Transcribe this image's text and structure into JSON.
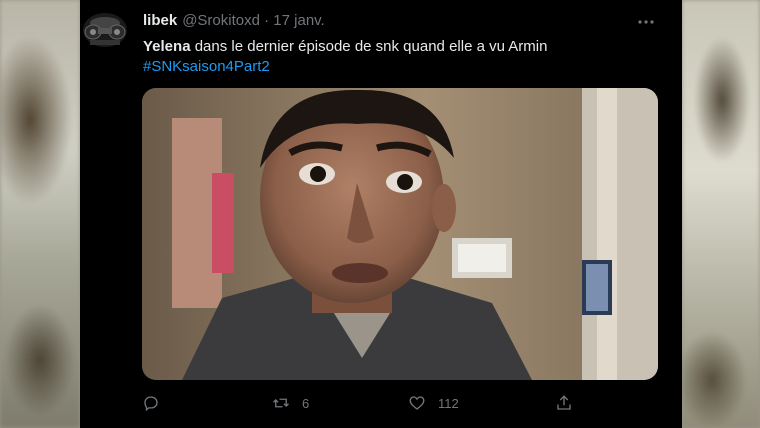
{
  "tweet": {
    "display_name": "libek",
    "handle": "@Srokitoxd",
    "separator": "·",
    "date": "17 janv.",
    "text_bold": "Yelena",
    "text_rest": " dans le dernier épisode de snk quand elle a vu Armin",
    "hashtag": "#SNKsaison4Part2"
  },
  "actions": {
    "retweets": "6",
    "likes": "112"
  },
  "icons": [
    "avatar",
    "more-icon",
    "reply-icon",
    "retweet-icon",
    "like-icon",
    "share-icon"
  ],
  "colors": {
    "background": "#000000",
    "text": "#e7e9ea",
    "secondary": "#71767b",
    "link": "#1d9bf0"
  }
}
